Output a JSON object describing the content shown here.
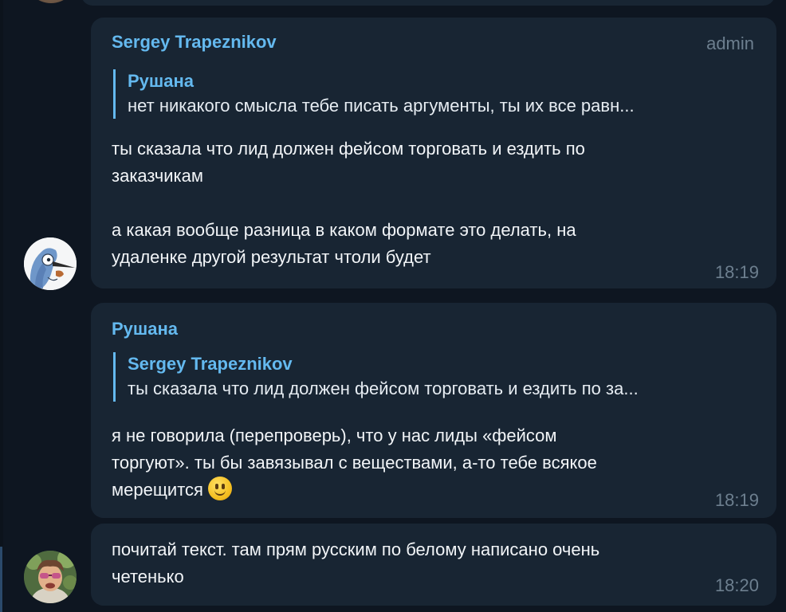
{
  "messages": [
    {
      "sender": "Sergey Trapeznikov",
      "role": "admin",
      "reply": {
        "author": "Рушана",
        "text": "нет никакого смысла тебе писать аргументы, ты их все равн..."
      },
      "lines": [
        "ты сказала что лид должен фейсом торговать и ездить по",
        "заказчикам",
        "",
        "а какая вообще разница в каком формате это делать, на",
        "удаленке другой результат чтоли будет"
      ],
      "time": "18:19"
    },
    {
      "sender": "Рушана",
      "reply": {
        "author": "Sergey Trapeznikov",
        "text": "ты сказала что лид должен фейсом торговать и ездить по за..."
      },
      "lines": [
        "я не говорила (перепроверь), что у нас лиды «фейсом",
        "торгуют». ты бы завязывал с веществами, а-то тебе всякое",
        "мерещится"
      ],
      "emoji": "slightly-smiling-face-icon",
      "time": "18:19"
    },
    {
      "lines": [
        "почитай текст. там прям русским по белому написано очень",
        "четенько"
      ],
      "time": "18:20"
    }
  ],
  "colors": {
    "background": "#0e1621",
    "bubble": "#182533",
    "accent": "#64b9ef",
    "text": "#f2f5f8",
    "muted": "#6d7f8f"
  }
}
